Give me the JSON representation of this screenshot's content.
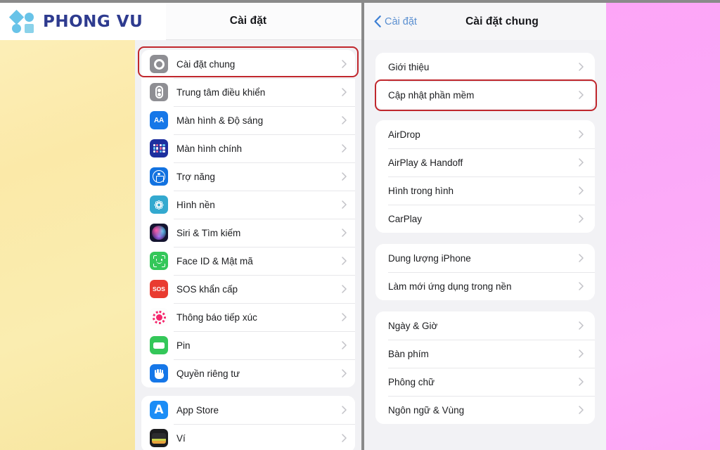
{
  "brand": {
    "name": "PHONG VU",
    "logo_icon": "phong-vu-logo-icon",
    "color": "#2e3b8f",
    "accent": "#68c3e8"
  },
  "highlight": {
    "color": "#c0272d"
  },
  "left_panel": {
    "nav": {
      "title": "Cài đặt"
    },
    "groups": [
      {
        "rows": [
          {
            "label": "Cài đặt chung",
            "icon": "gear-icon",
            "highlighted": true
          },
          {
            "label": "Trung tâm điều khiển",
            "icon": "control-center-icon",
            "highlighted": false
          },
          {
            "label": "Màn hình & Độ sáng",
            "icon": "display-brightness-icon",
            "highlighted": false
          },
          {
            "label": "Màn hình chính",
            "icon": "home-screen-icon",
            "highlighted": false
          },
          {
            "label": "Trợ năng",
            "icon": "accessibility-icon",
            "highlighted": false
          },
          {
            "label": "Hình nền",
            "icon": "wallpaper-icon",
            "highlighted": false
          },
          {
            "label": "Siri & Tìm kiếm",
            "icon": "siri-icon",
            "highlighted": false
          },
          {
            "label": "Face ID & Mật mã",
            "icon": "face-id-icon",
            "highlighted": false
          },
          {
            "label": "SOS khẩn cấp",
            "icon": "sos-icon",
            "highlighted": false
          },
          {
            "label": "Thông báo tiếp xúc",
            "icon": "exposure-notification-icon",
            "highlighted": false
          },
          {
            "label": "Pin",
            "icon": "battery-icon",
            "highlighted": false
          },
          {
            "label": "Quyền riêng tư",
            "icon": "privacy-hand-icon",
            "highlighted": false
          }
        ]
      },
      {
        "rows": [
          {
            "label": "App Store",
            "icon": "app-store-icon",
            "highlighted": false
          },
          {
            "label": "Ví",
            "icon": "wallet-icon",
            "highlighted": false
          }
        ]
      }
    ]
  },
  "right_panel": {
    "nav": {
      "back_label": "Cài đặt",
      "back_icon": "chevron-left-icon",
      "title": "Cài đặt chung"
    },
    "groups": [
      {
        "rows": [
          {
            "label": "Giới thiệu",
            "highlighted": false
          },
          {
            "label": "Cập nhật phần mềm",
            "highlighted": true
          }
        ]
      },
      {
        "rows": [
          {
            "label": "AirDrop",
            "highlighted": false
          },
          {
            "label": "AirPlay & Handoff",
            "highlighted": false
          },
          {
            "label": "Hình trong hình",
            "highlighted": false
          },
          {
            "label": "CarPlay",
            "highlighted": false
          }
        ]
      },
      {
        "rows": [
          {
            "label": "Dung lượng iPhone",
            "highlighted": false
          },
          {
            "label": "Làm mới ứng dụng trong nền",
            "highlighted": false
          }
        ]
      },
      {
        "rows": [
          {
            "label": "Ngày & Giờ",
            "highlighted": false
          },
          {
            "label": "Bàn phím",
            "highlighted": false
          },
          {
            "label": "Phông chữ",
            "highlighted": false
          },
          {
            "label": "Ngôn ngữ & Vùng",
            "highlighted": false
          }
        ]
      }
    ]
  }
}
